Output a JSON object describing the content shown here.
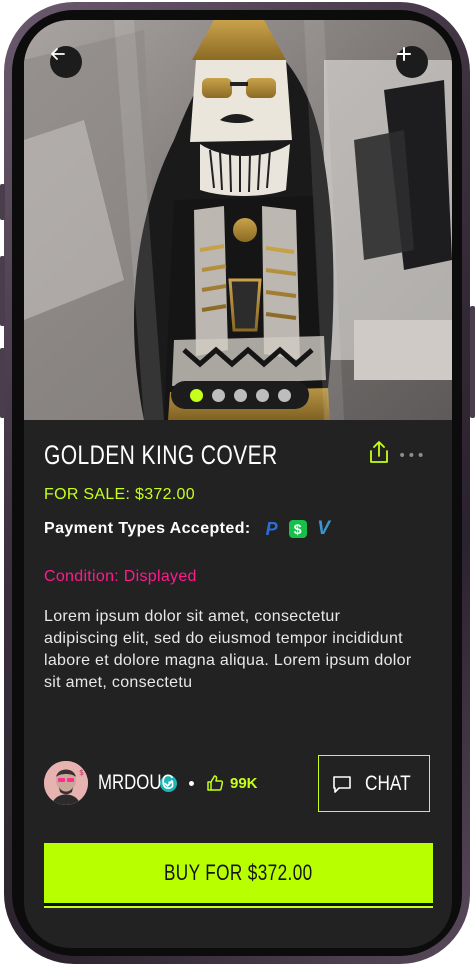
{
  "product": {
    "title": "GOLDEN KING COVER",
    "price_text": "FOR SALE: $372.00",
    "condition_text": "Condition: Displayed",
    "description": "Lorem ipsum dolor sit amet, consectetur adipiscing elit, sed do eiusmod tempor incididunt labore et dolore magna aliqua. Lorem ipsum dolor sit amet, consectetu"
  },
  "payment": {
    "label": "Payment Types Accepted:",
    "methods": [
      {
        "name": "paypal-icon",
        "glyph": "P"
      },
      {
        "name": "cashapp-icon",
        "glyph": "$"
      },
      {
        "name": "venmo-icon",
        "glyph": "V"
      }
    ]
  },
  "gallery": {
    "slide_count": 5,
    "active_index": 0
  },
  "seller": {
    "username": "MRDOUG",
    "likes": "99K"
  },
  "actions": {
    "chat_label": "CHAT",
    "buy_label": "BUY FOR $372.00"
  },
  "colors": {
    "accent": "#c6ff1a",
    "buy_button": "#b8ff00",
    "condition": "#ff1a8c",
    "background": "#222223",
    "verified": "#1fb5b8"
  }
}
